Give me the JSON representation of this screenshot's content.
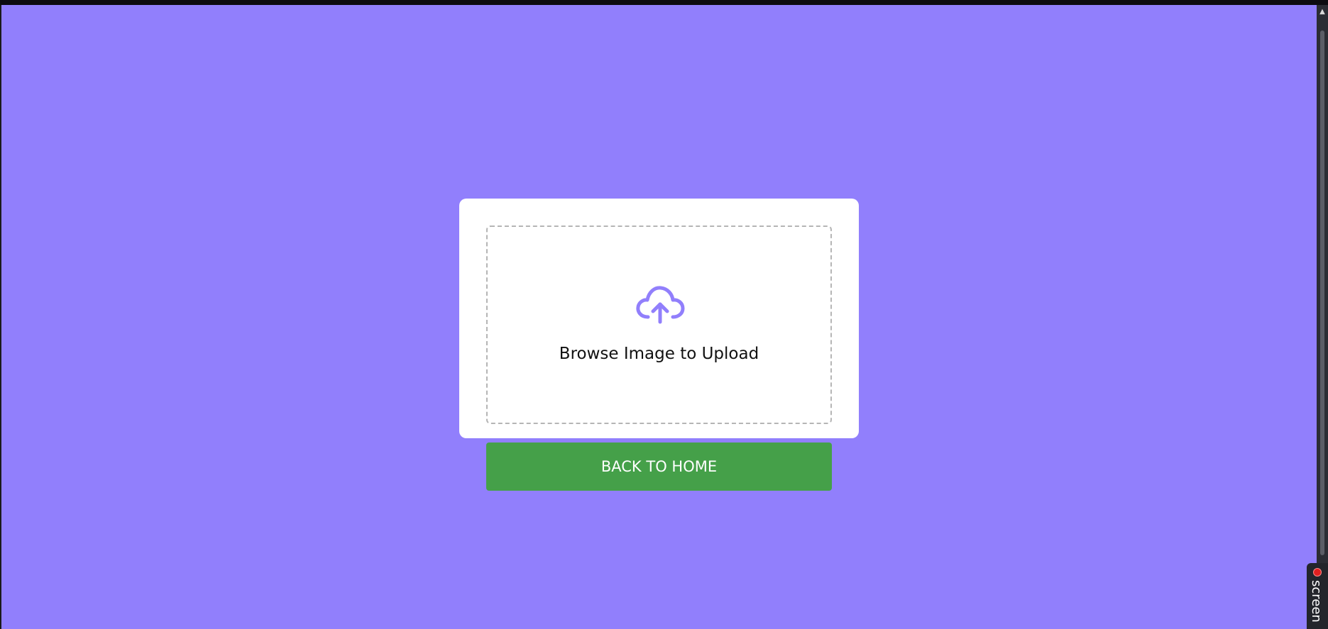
{
  "upload": {
    "label": "Browse Image to Upload",
    "icon": "cloud-upload-icon"
  },
  "actions": {
    "back_home_label": "BACK TO HOME"
  },
  "recorder": {
    "label": "screen"
  },
  "colors": {
    "background": "#917ffc",
    "card": "#ffffff",
    "accent": "#917ffc",
    "button": "#45a049",
    "button_text": "#ffffff"
  }
}
